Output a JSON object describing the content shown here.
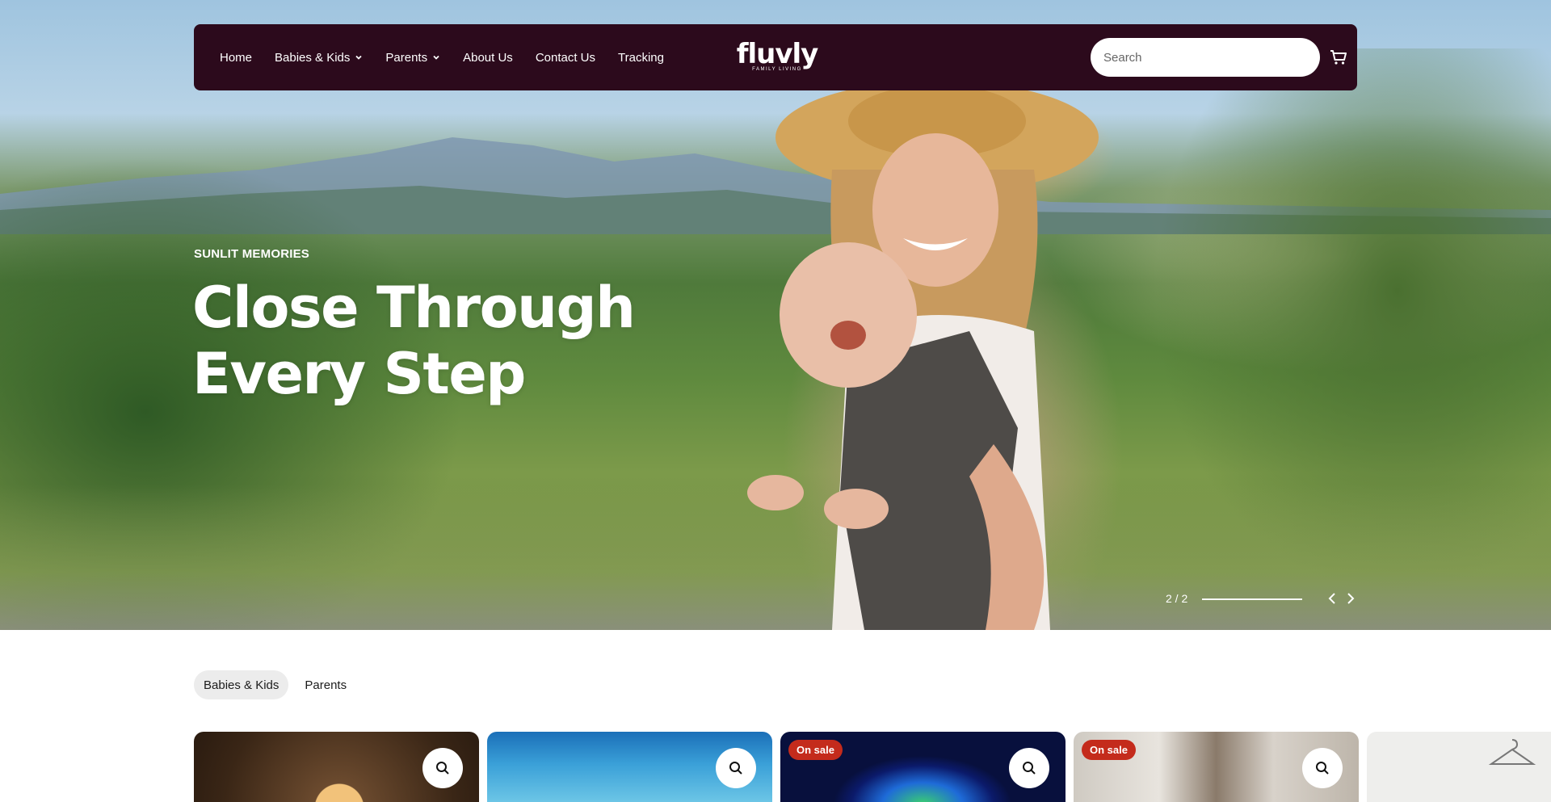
{
  "nav": {
    "links": [
      {
        "label": "Home"
      },
      {
        "label": "Babies & Kids",
        "has_dropdown": true
      },
      {
        "label": "Parents",
        "has_dropdown": true
      },
      {
        "label": "About Us"
      },
      {
        "label": "Contact Us"
      },
      {
        "label": "Tracking"
      }
    ],
    "logo_text": "fluvly",
    "logo_tagline": "FAMILY LIVING",
    "search_placeholder": "Search",
    "cart_icon": "cart-icon"
  },
  "hero": {
    "eyebrow": "SUNLIT MEMORIES",
    "headline_line1": "Close Through",
    "headline_line2": "Every Step",
    "slide_counter": "2 / 2",
    "slide_progress": 1.0,
    "prev_icon": "chevron-left-icon",
    "next_icon": "chevron-right-icon"
  },
  "tabs": [
    {
      "label": "Babies & Kids",
      "active": true
    },
    {
      "label": "Parents",
      "active": false
    }
  ],
  "products": [
    {
      "on_sale": false
    },
    {
      "on_sale": false
    },
    {
      "on_sale": true,
      "badge": "On sale"
    },
    {
      "on_sale": true,
      "badge": "On sale"
    },
    {
      "on_sale": false
    }
  ],
  "colors": {
    "nav_bg": "#2c0a1c",
    "sale_badge": "#c42b1c",
    "active_tab_bg": "#ececec"
  }
}
